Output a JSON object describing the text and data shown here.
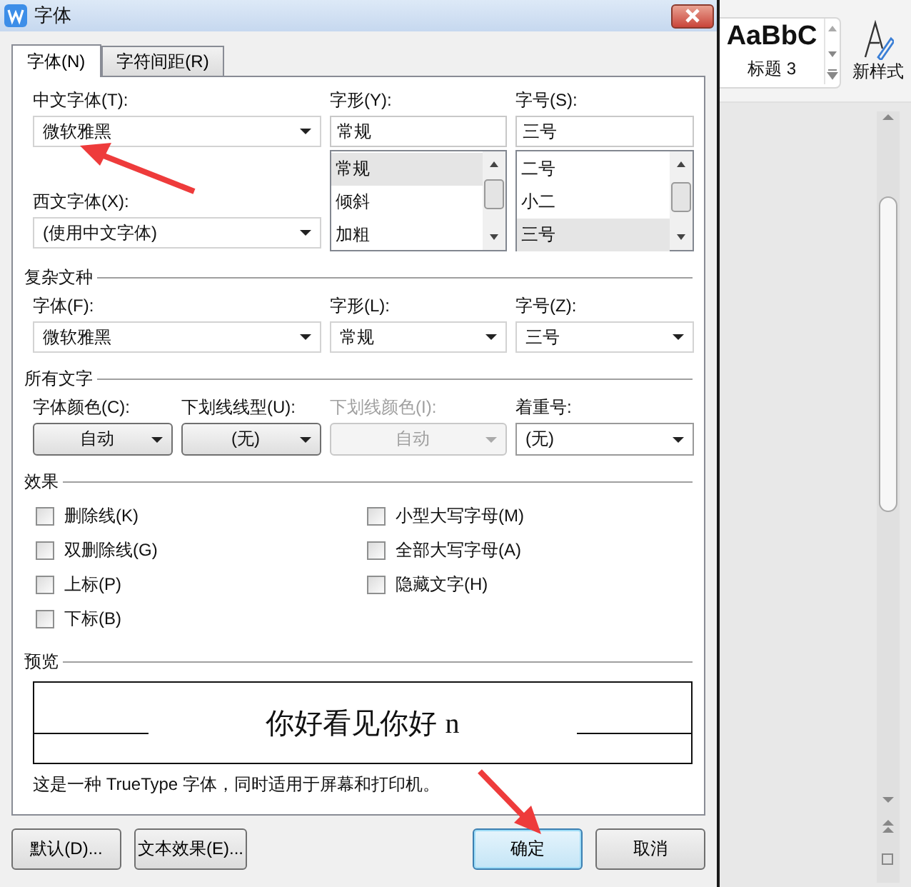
{
  "window": {
    "title": "字体"
  },
  "tabs": [
    {
      "label": "字体(N)",
      "selected": true
    },
    {
      "label": "字符间距(R)",
      "selected": false
    }
  ],
  "chinese_font": {
    "label": "中文字体(T):",
    "value": "微软雅黑"
  },
  "western_font": {
    "label": "西文字体(X):",
    "value": "(使用中文字体)"
  },
  "font_style": {
    "label": "字形(Y):",
    "value": "常规",
    "options": [
      {
        "label": "常规",
        "selected": true
      },
      {
        "label": "倾斜",
        "selected": false
      },
      {
        "label": "加粗",
        "selected": false
      }
    ]
  },
  "font_size": {
    "label": "字号(S):",
    "value": "三号",
    "options": [
      {
        "label": "二号",
        "selected": false
      },
      {
        "label": "小二",
        "selected": false
      },
      {
        "label": "三号",
        "selected": true
      }
    ]
  },
  "complex_script": {
    "title": "复杂文种",
    "fields": [
      {
        "label": "字体(F):",
        "value": "微软雅黑"
      },
      {
        "label": "字形(L):",
        "value": "常规"
      },
      {
        "label": "字号(Z):",
        "value": "三号"
      }
    ]
  },
  "all_text": {
    "title": "所有文字",
    "fields": [
      {
        "label": "字体颜色(C):",
        "value": "自动",
        "kind": "button",
        "disabled": false
      },
      {
        "label": "下划线线型(U):",
        "value": "(无)",
        "kind": "button",
        "disabled": false
      },
      {
        "label": "下划线颜色(I):",
        "value": "自动",
        "kind": "button",
        "disabled": true
      },
      {
        "label": "着重号:",
        "value": "(无)",
        "kind": "select",
        "disabled": false
      }
    ]
  },
  "effects": {
    "title": "效果",
    "columns": [
      [
        {
          "label": "删除线(K)",
          "checked": false
        },
        {
          "label": "双删除线(G)",
          "checked": false
        },
        {
          "label": "上标(P)",
          "checked": false
        },
        {
          "label": "下标(B)",
          "checked": false
        }
      ],
      [
        {
          "label": "小型大写字母(M)",
          "checked": false
        },
        {
          "label": "全部大写字母(A)",
          "checked": false
        },
        {
          "label": "隐藏文字(H)",
          "checked": false
        }
      ]
    ]
  },
  "preview": {
    "title": "预览",
    "sample": "你好看见你好",
    "sample_latin": "n",
    "note": "这是一种 TrueType 字体，同时适用于屏幕和打印机。"
  },
  "buttons": [
    {
      "label": "默认(D)...",
      "default": false
    },
    {
      "label": "文本效果(E)...",
      "default": false
    },
    {
      "label": "确定",
      "default": true
    },
    {
      "label": "取消",
      "default": false
    }
  ],
  "ribbon": {
    "style_preview": "AaBbC",
    "style_name": "标题 3",
    "new_style": "新样式"
  }
}
